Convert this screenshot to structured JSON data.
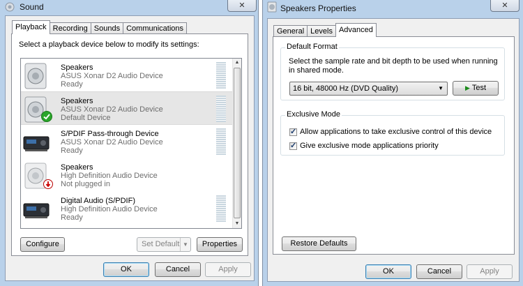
{
  "sound_window": {
    "title": "Sound",
    "close_glyph": "✕",
    "tabs": [
      {
        "label": "Playback",
        "active": true
      },
      {
        "label": "Recording",
        "active": false
      },
      {
        "label": "Sounds",
        "active": false
      },
      {
        "label": "Communications",
        "active": false
      }
    ],
    "instruction": "Select a playback device below to modify its settings:",
    "devices": [
      {
        "name": "Speakers",
        "description": "ASUS Xonar D2 Audio Device",
        "status": "Ready",
        "icon": "speaker-icon",
        "badge": "",
        "selected": false
      },
      {
        "name": "Speakers",
        "description": "ASUS Xonar D2 Audio Device",
        "status": "Default Device",
        "icon": "speaker-icon",
        "badge": "default-check-icon",
        "selected": true
      },
      {
        "name": "S/PDIF Pass-through Device",
        "description": "ASUS Xonar D2 Audio Device",
        "status": "Ready",
        "icon": "receiver-icon",
        "badge": "",
        "selected": false
      },
      {
        "name": "Speakers",
        "description": "High Definition Audio Device",
        "status": "Not plugged in",
        "icon": "speaker-icon",
        "badge": "unplugged-icon",
        "selected": false
      },
      {
        "name": "Digital Audio (S/PDIF)",
        "description": "High Definition Audio Device",
        "status": "Ready",
        "icon": "receiver-icon",
        "badge": "",
        "selected": false
      }
    ],
    "buttons": {
      "configure": "Configure",
      "set_default": "Set Default",
      "properties": "Properties",
      "ok": "OK",
      "cancel": "Cancel",
      "apply": "Apply"
    }
  },
  "properties_window": {
    "title": "Speakers Properties",
    "close_glyph": "✕",
    "tabs": [
      {
        "label": "General",
        "active": false
      },
      {
        "label": "Levels",
        "active": false
      },
      {
        "label": "Advanced",
        "active": true
      }
    ],
    "default_format": {
      "group_label": "Default Format",
      "description": "Select the sample rate and bit depth to be used when running in shared mode.",
      "selected_format": "16 bit, 48000 Hz (DVD Quality)",
      "test_label": "Test"
    },
    "exclusive_mode": {
      "group_label": "Exclusive Mode",
      "allow_label": "Allow applications to take exclusive control of this device",
      "allow_checked": true,
      "priority_label": "Give exclusive mode applications priority",
      "priority_checked": true
    },
    "buttons": {
      "restore_defaults": "Restore Defaults",
      "ok": "OK",
      "cancel": "Cancel",
      "apply": "Apply"
    }
  }
}
